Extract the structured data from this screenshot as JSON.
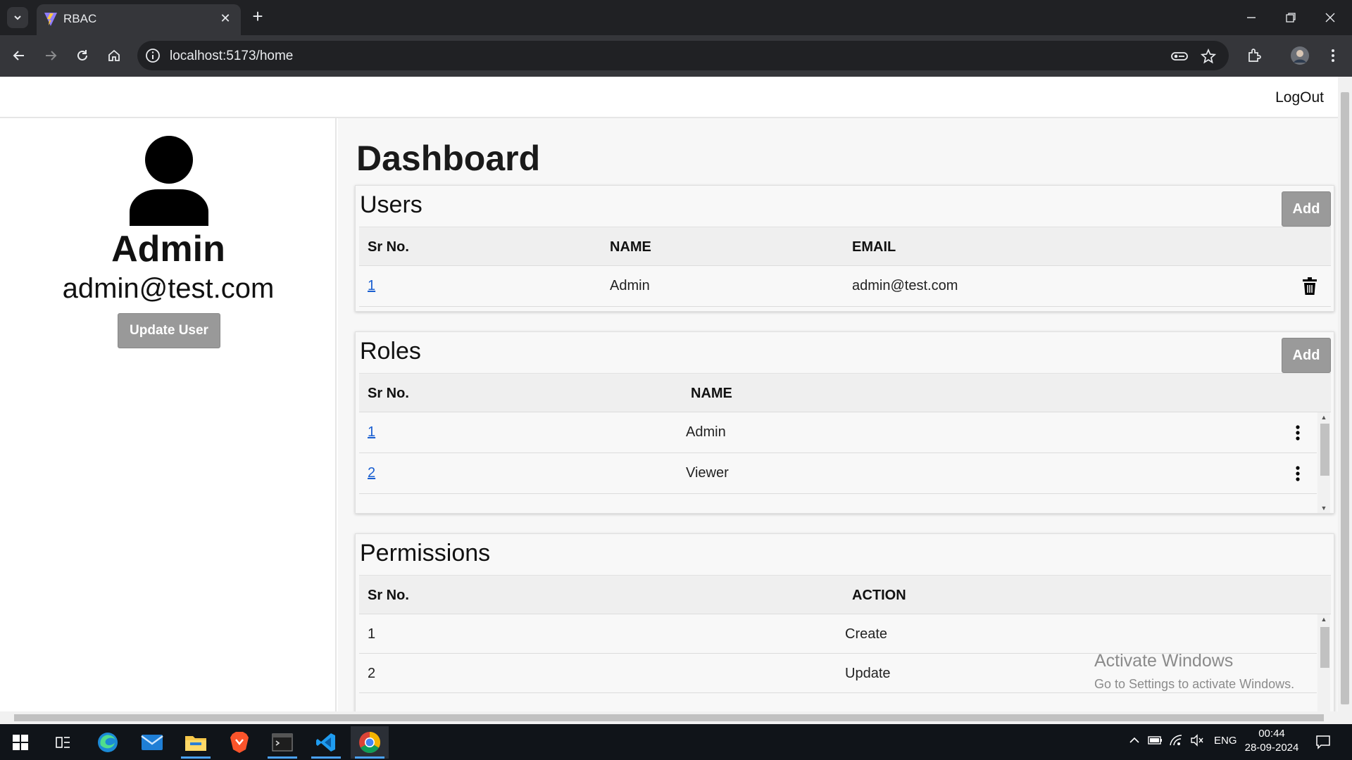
{
  "browser": {
    "tab_title": "RBAC",
    "url": "localhost:5173/home"
  },
  "header": {
    "logout_label": "LogOut"
  },
  "sidebar": {
    "name": "Admin",
    "email": "admin@test.com",
    "update_button_label": "Update User"
  },
  "main": {
    "title": "Dashboard",
    "users": {
      "title": "Users",
      "add_label": "Add",
      "columns": [
        "Sr No.",
        "NAME",
        "EMAIL"
      ],
      "rows": [
        {
          "sr": "1",
          "name": "Admin",
          "email": "admin@test.com"
        }
      ]
    },
    "roles": {
      "title": "Roles",
      "add_label": "Add",
      "columns": [
        "Sr No.",
        "NAME"
      ],
      "rows": [
        {
          "sr": "1",
          "name": "Admin"
        },
        {
          "sr": "2",
          "name": "Viewer"
        }
      ]
    },
    "permissions": {
      "title": "Permissions",
      "columns": [
        "Sr No.",
        "ACTION"
      ],
      "rows": [
        {
          "sr": "1",
          "action": "Create"
        },
        {
          "sr": "2",
          "action": "Update"
        }
      ]
    }
  },
  "watermark": {
    "title": "Activate Windows",
    "subtitle": "Go to Settings to activate Windows."
  },
  "taskbar": {
    "language": "ENG",
    "time": "00:44",
    "date": "28-09-2024"
  },
  "colors": {
    "link": "#1a5fd1",
    "button_gray": "#9a9a9a",
    "chrome_dark": "#202124"
  },
  "icons": [
    "chevron-down-icon",
    "vite-favicon-icon",
    "close-icon",
    "plus-icon",
    "minimize-icon",
    "restore-icon",
    "back-icon",
    "forward-icon",
    "reload-icon",
    "home-icon",
    "info-icon",
    "key-icon",
    "star-icon",
    "extensions-icon",
    "profile-avatar-icon",
    "kebab-menu-icon",
    "user-avatar-icon",
    "trash-icon",
    "kebab-icon",
    "windows-start-icon",
    "task-view-icon",
    "edge-icon",
    "mail-icon",
    "file-explorer-icon",
    "brave-icon",
    "terminal-icon",
    "vscode-icon",
    "chrome-icon",
    "battery-icon",
    "wifi-icon",
    "speaker-muted-icon",
    "notification-icon"
  ]
}
